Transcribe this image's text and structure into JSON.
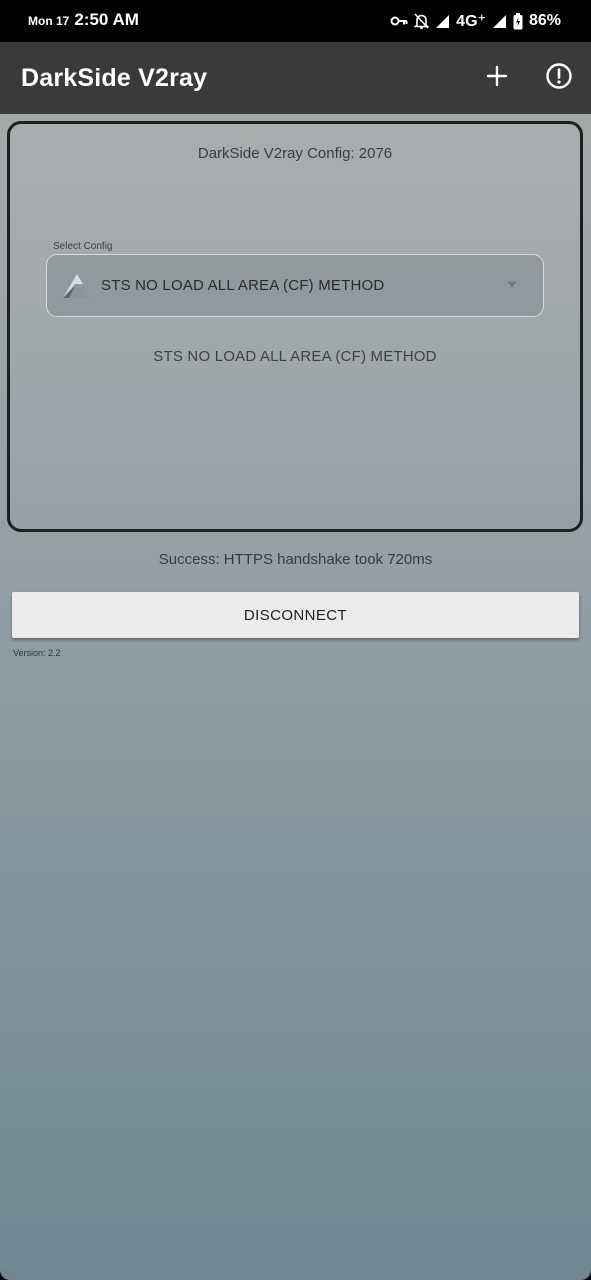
{
  "status_bar": {
    "date": "Mon 17",
    "time": "2:50 AM",
    "network": "4G⁺",
    "battery": "86%",
    "icons": [
      "vpn-key-icon",
      "alarm-off-icon",
      "signal-icon",
      "signal-icon",
      "battery-icon"
    ]
  },
  "app_bar": {
    "title": "DarkSide V2ray",
    "actions": [
      "add-icon",
      "info-icon"
    ]
  },
  "config_card": {
    "count_text": "DarkSide V2ray Config: 2076",
    "select_label": "Select Config",
    "selected_value": "STS NO LOAD ALL AREA (CF) METHOD",
    "selected_config_text": "STS NO LOAD ALL AREA (CF) METHOD"
  },
  "status_message": "Success: HTTPS handshake took 720ms",
  "disconnect_label": "DISCONNECT",
  "version": "Version: 2.2"
}
